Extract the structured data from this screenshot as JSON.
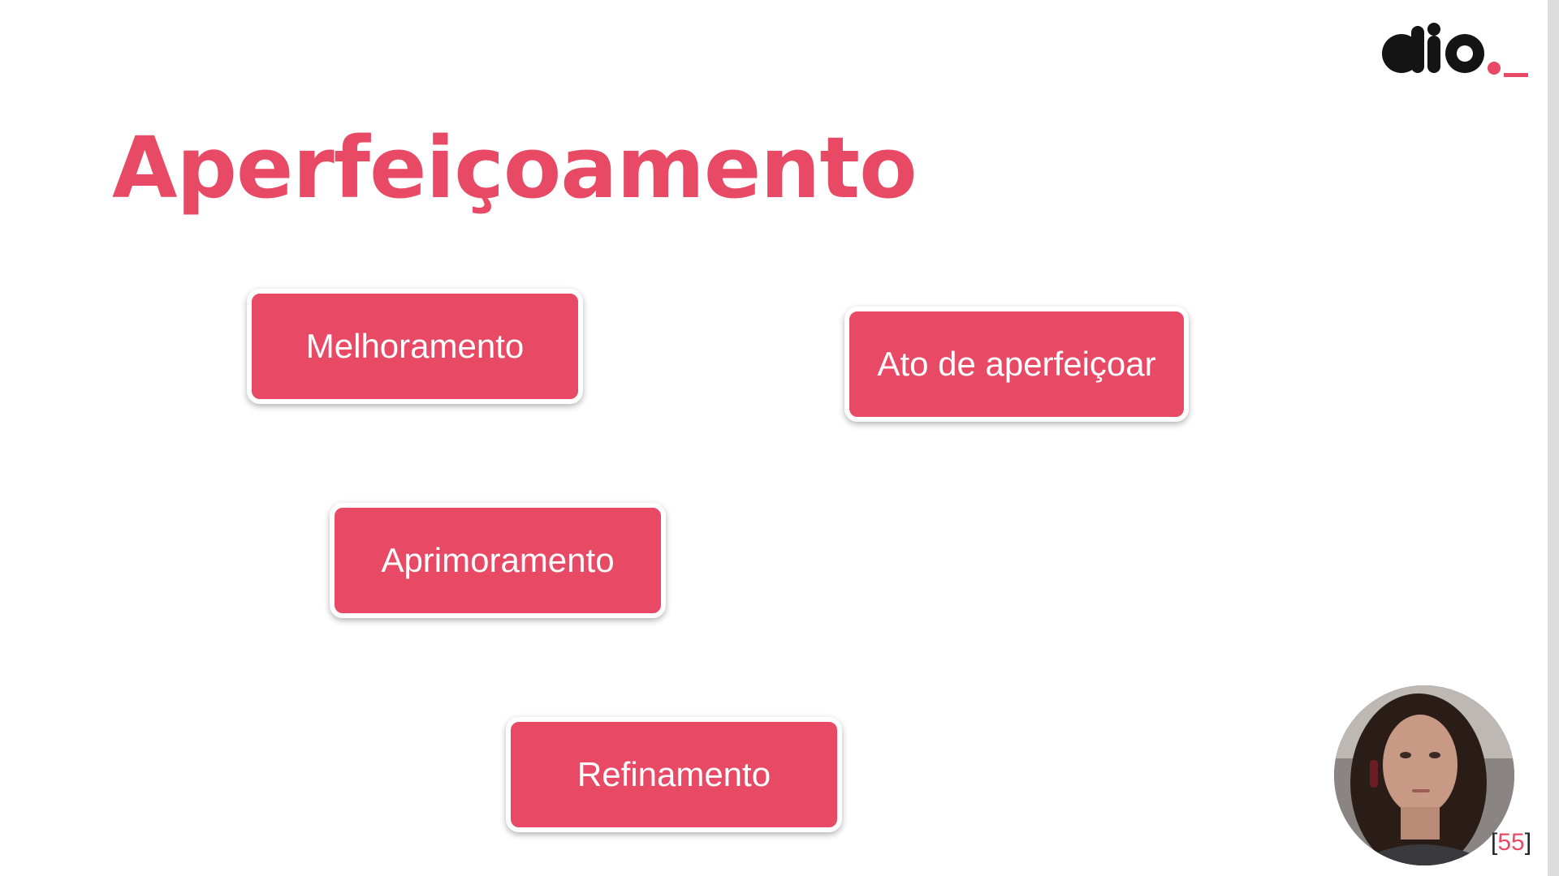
{
  "slide": {
    "title": "Aperfeiçoamento",
    "accent_color": "#e84a65",
    "cards": [
      {
        "label": "Melhoramento"
      },
      {
        "label": "Ato de aperfeiçoar"
      },
      {
        "label": "Aprimoramento"
      },
      {
        "label": "Refinamento"
      }
    ],
    "page_number": "55",
    "page_open": "[",
    "page_close": "]"
  },
  "logo": {
    "text": "dio._",
    "icon": "dio-logo-icon"
  },
  "webcam": {
    "icon": "presenter-webcam-icon"
  }
}
